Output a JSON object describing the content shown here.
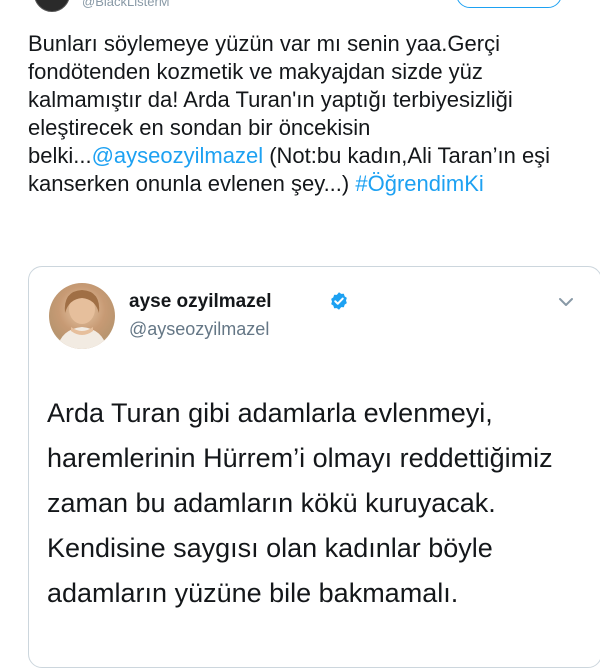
{
  "header": {
    "handle": "@BlackListerM"
  },
  "tweet": {
    "text_before_mention": "Bunları söylemeye yüzün var mı senin yaa.Gerçi fondötenden kozmetik ve makyajdan sizde yüz kalmamıştır da! Arda Turan'ın yaptığı terbiyesizliği eleştirecek en sondan bir öncekisin belki...",
    "mention": "@ayseozyilmazel",
    "text_after_mention": " (Not:bu kadın,Ali Taran’ın eşi kanserken onunla evlenen şey...) ",
    "hashtag": "#ÖğrendimKi"
  },
  "quoted_tweet": {
    "name": "ayse ozyilmazel",
    "handle": "@ayseozyilmazel",
    "verified": true,
    "text": "Arda Turan gibi adamlarla evlenmeyi, haremlerinin Hürrem’i olmayı reddettiğimiz zaman bu adamların kökü kuruyacak. Kendisine saygısı olan kadınlar böyle adamların yüzüne bile bakmamalı."
  },
  "colors": {
    "link": "#1da1f2",
    "text": "#14171a",
    "secondary": "#657786",
    "border": "#ccd6dd"
  },
  "icons": {
    "verified": "verified-badge-icon",
    "menu": "chevron-down-icon"
  }
}
